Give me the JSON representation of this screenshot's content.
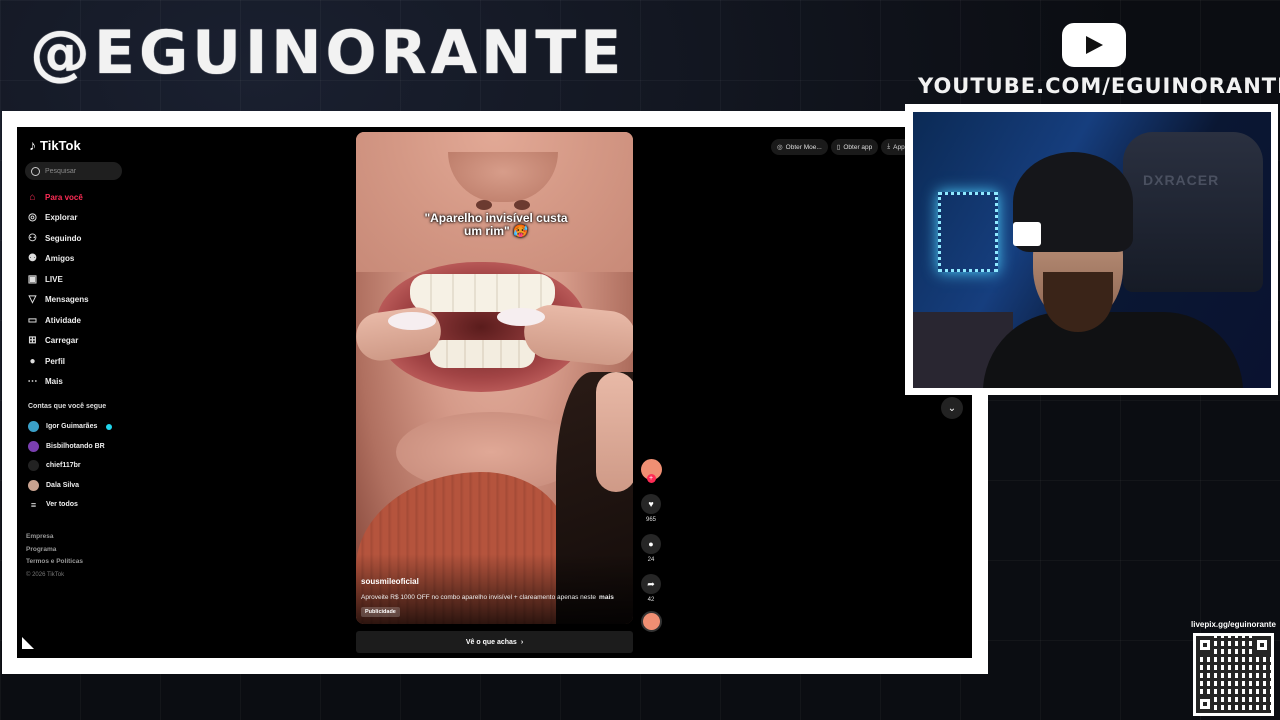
{
  "overlay": {
    "handle": "@EGUINORANTE",
    "youtube_url": "YOUTUBE.COM/EGUINORANTE",
    "livepix": "livepix.gg/eguinorante",
    "webcam_chair_brand": "DXRACER"
  },
  "tiktok": {
    "logo": "TikTok",
    "search_placeholder": "Pesquisar",
    "nav": [
      {
        "label": "Para você",
        "icon": "home-icon",
        "active": true
      },
      {
        "label": "Explorar",
        "icon": "compass-icon"
      },
      {
        "label": "Seguindo",
        "icon": "following-icon"
      },
      {
        "label": "Amigos",
        "icon": "friends-icon"
      },
      {
        "label": "LIVE",
        "icon": "live-icon"
      },
      {
        "label": "Mensagens",
        "icon": "messages-icon"
      },
      {
        "label": "Atividade",
        "icon": "activity-icon"
      },
      {
        "label": "Carregar",
        "icon": "upload-icon"
      },
      {
        "label": "Perfil",
        "icon": "profile-icon"
      },
      {
        "label": "Mais",
        "icon": "more-icon"
      }
    ],
    "following_title": "Contas que você segue",
    "following": [
      {
        "name": "Igor Guimarães",
        "verified": true,
        "color": "#3aa0c8"
      },
      {
        "name": "Bisbilhotando BR",
        "color": "#7a3fb0"
      },
      {
        "name": "chief117br",
        "color": "#222"
      },
      {
        "name": "Dala Silva",
        "color": "#c9a390"
      },
      {
        "name": "Ver todos",
        "color": "#000"
      }
    ],
    "footer": [
      "Empresa",
      "Programa",
      "Termos e Políticas"
    ],
    "copyright": "© 2026 TikTok",
    "top_actions": [
      "Obter Moe...",
      "Obter app",
      "App p"
    ],
    "video": {
      "overlay_text": "\"Aparelho invisível custa um rim\" 🥵",
      "author": "sousmileoficial",
      "description": "Aproveite R$ 1000 OFF no combo aparelho invisível + clareamento apenas neste",
      "more": "mais",
      "badge": "Publicidade",
      "likes": "965",
      "comments": "24",
      "shares": "42"
    },
    "cta": "Vê o que achas"
  }
}
